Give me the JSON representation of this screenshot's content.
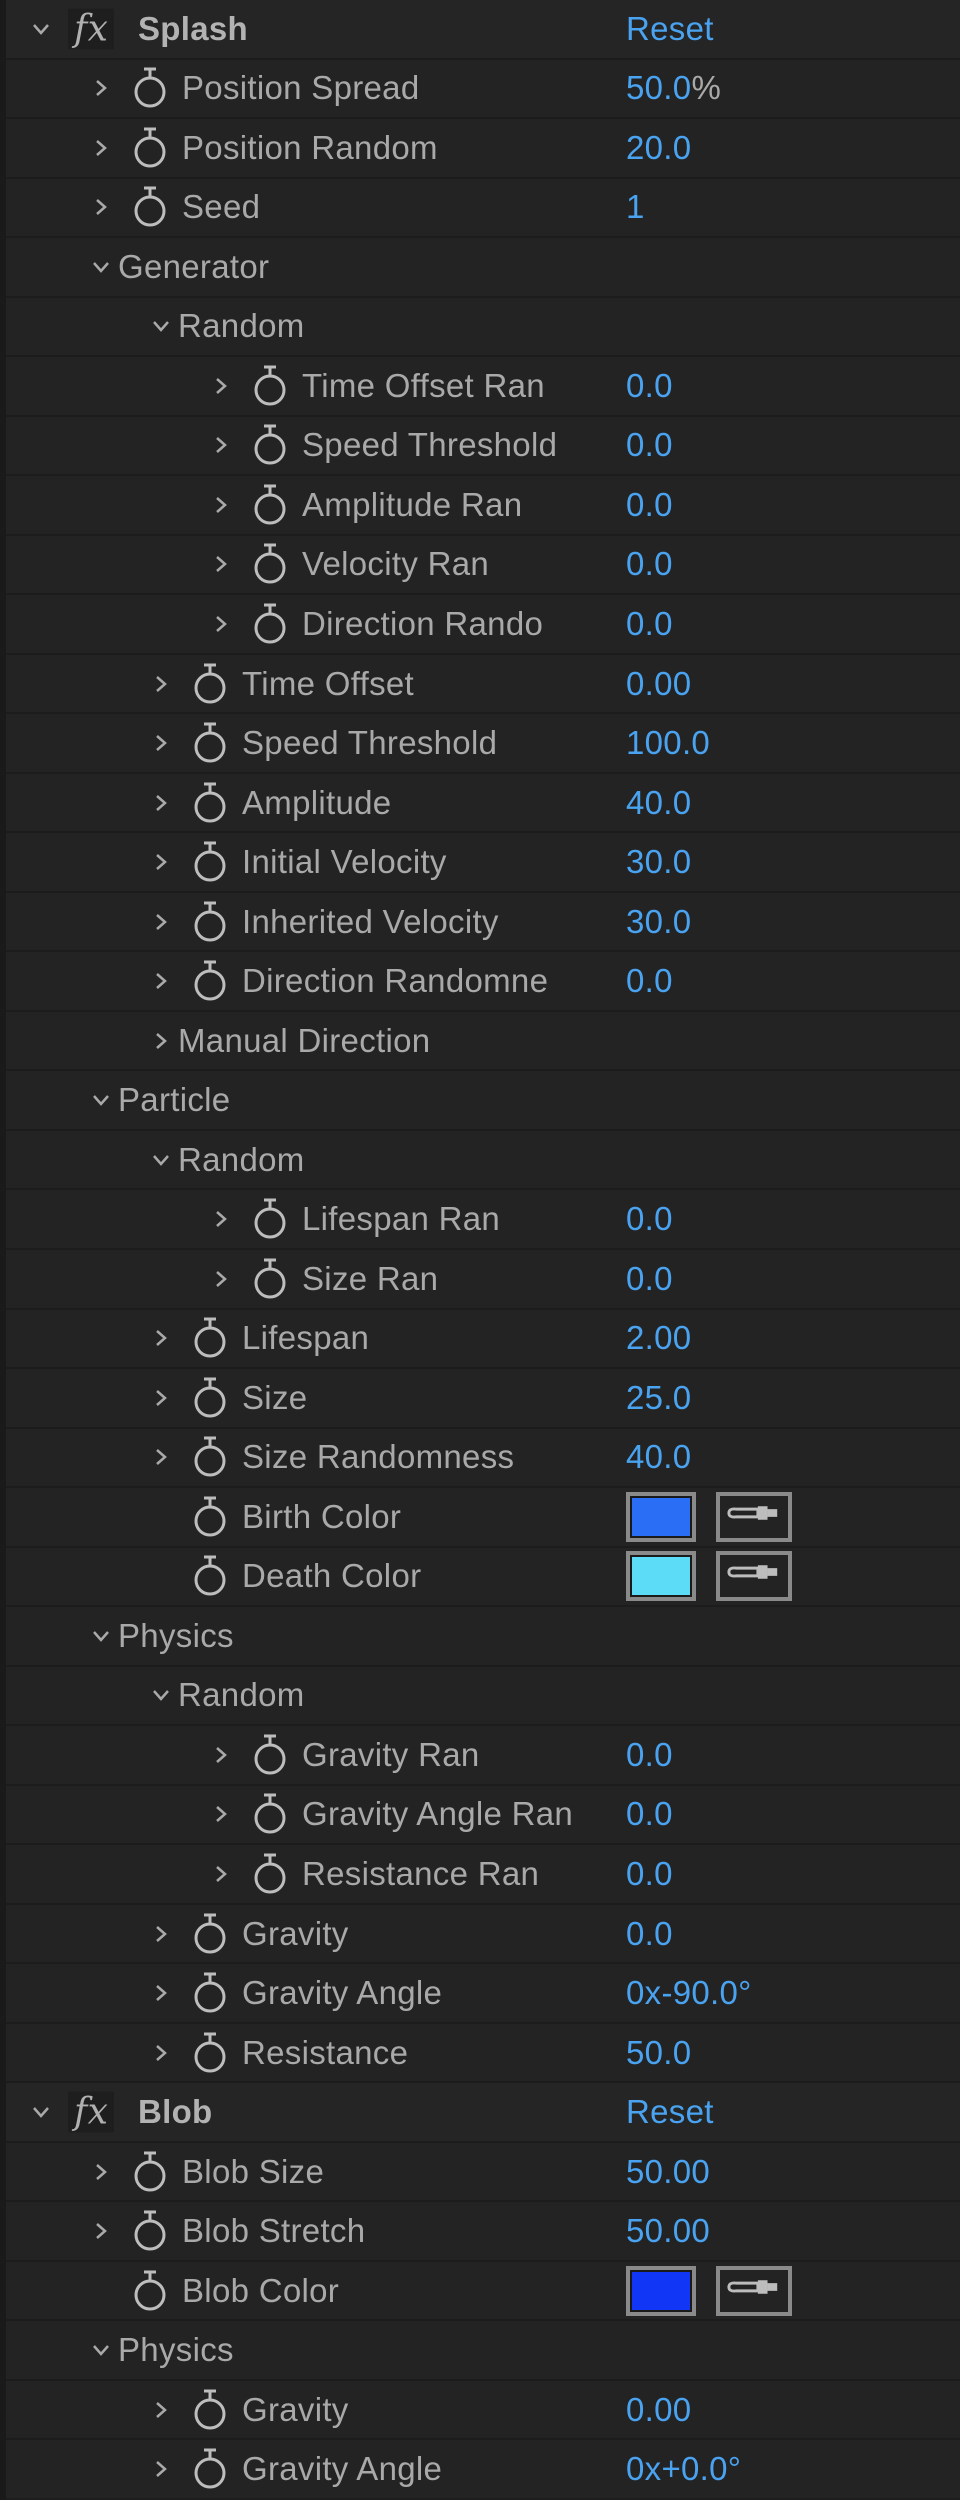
{
  "accent_color": "#4aa3f0",
  "rows": [
    {
      "level": 0,
      "kind": "effect",
      "chevron": "open",
      "label": "Splash",
      "reset": "Reset"
    },
    {
      "level": 1,
      "kind": "prop",
      "chevron": "closed",
      "label": "Position Spread",
      "value": "50.0",
      "unit": "%"
    },
    {
      "level": 1,
      "kind": "prop",
      "chevron": "closed",
      "label": "Position Random",
      "value": "20.0"
    },
    {
      "level": 1,
      "kind": "prop",
      "chevron": "closed",
      "label": "Seed",
      "value": "1"
    },
    {
      "level": 1,
      "kind": "group",
      "chevron": "open",
      "label": "Generator"
    },
    {
      "level": 2,
      "kind": "group",
      "chevron": "open",
      "label": "Random"
    },
    {
      "level": 3,
      "kind": "prop",
      "chevron": "closed",
      "label": "Time Offset Ran",
      "value": "0.0"
    },
    {
      "level": 3,
      "kind": "prop",
      "chevron": "closed",
      "label": "Speed Threshold",
      "value": "0.0"
    },
    {
      "level": 3,
      "kind": "prop",
      "chevron": "closed",
      "label": "Amplitude Ran",
      "value": "0.0"
    },
    {
      "level": 3,
      "kind": "prop",
      "chevron": "closed",
      "label": "Velocity Ran",
      "value": "0.0"
    },
    {
      "level": 3,
      "kind": "prop",
      "chevron": "closed",
      "label": "Direction Rando",
      "value": "0.0"
    },
    {
      "level": 2,
      "kind": "prop",
      "chevron": "closed",
      "label": "Time Offset",
      "value": "0.00"
    },
    {
      "level": 2,
      "kind": "prop",
      "chevron": "closed",
      "label": "Speed Threshold",
      "value": "100.0"
    },
    {
      "level": 2,
      "kind": "prop",
      "chevron": "closed",
      "label": "Amplitude",
      "value": "40.0"
    },
    {
      "level": 2,
      "kind": "prop",
      "chevron": "closed",
      "label": "Initial Velocity",
      "value": "30.0"
    },
    {
      "level": 2,
      "kind": "prop",
      "chevron": "closed",
      "label": "Inherited Velocity",
      "value": "30.0"
    },
    {
      "level": 2,
      "kind": "prop",
      "chevron": "closed",
      "label": "Direction Randomne",
      "value": "0.0"
    },
    {
      "level": 2,
      "kind": "group",
      "chevron": "closed",
      "label": "Manual Direction"
    },
    {
      "level": 1,
      "kind": "group",
      "chevron": "open",
      "label": "Particle"
    },
    {
      "level": 2,
      "kind": "group",
      "chevron": "open",
      "label": "Random"
    },
    {
      "level": 3,
      "kind": "prop",
      "chevron": "closed",
      "label": "Lifespan Ran",
      "value": "0.0"
    },
    {
      "level": 3,
      "kind": "prop",
      "chevron": "closed",
      "label": "Size Ran",
      "value": "0.0"
    },
    {
      "level": 2,
      "kind": "prop",
      "chevron": "closed",
      "label": "Lifespan",
      "value": "2.00"
    },
    {
      "level": 2,
      "kind": "prop",
      "chevron": "closed",
      "label": "Size",
      "value": "25.0"
    },
    {
      "level": 2,
      "kind": "prop",
      "chevron": "closed",
      "label": "Size Randomness",
      "value": "40.0"
    },
    {
      "level": 2,
      "kind": "color",
      "chevron": "none",
      "label": "Birth Color",
      "color": "#2a6ef5"
    },
    {
      "level": 2,
      "kind": "color",
      "chevron": "none",
      "label": "Death Color",
      "color": "#5ddcf8"
    },
    {
      "level": 1,
      "kind": "group",
      "chevron": "open",
      "label": "Physics"
    },
    {
      "level": 2,
      "kind": "group",
      "chevron": "open",
      "label": "Random"
    },
    {
      "level": 3,
      "kind": "prop",
      "chevron": "closed",
      "label": "Gravity Ran",
      "value": "0.0"
    },
    {
      "level": 3,
      "kind": "prop",
      "chevron": "closed",
      "label": "Gravity Angle Ran",
      "value": "0.0"
    },
    {
      "level": 3,
      "kind": "prop",
      "chevron": "closed",
      "label": "Resistance Ran",
      "value": "0.0"
    },
    {
      "level": 2,
      "kind": "prop",
      "chevron": "closed",
      "label": "Gravity",
      "value": "0.0"
    },
    {
      "level": 2,
      "kind": "prop",
      "chevron": "closed",
      "label": "Gravity Angle",
      "value": "0x-90.0°"
    },
    {
      "level": 2,
      "kind": "prop",
      "chevron": "closed",
      "label": "Resistance",
      "value": "50.0"
    },
    {
      "level": 0,
      "kind": "effect",
      "chevron": "open",
      "label": "Blob",
      "reset": "Reset"
    },
    {
      "level": 1,
      "kind": "prop",
      "chevron": "closed",
      "label": "Blob Size",
      "value": "50.00"
    },
    {
      "level": 1,
      "kind": "prop",
      "chevron": "closed",
      "label": "Blob Stretch",
      "value": "50.00"
    },
    {
      "level": 1,
      "kind": "color",
      "chevron": "none",
      "label": "Blob Color",
      "color": "#1236f5"
    },
    {
      "level": 1,
      "kind": "group",
      "chevron": "open",
      "label": "Physics"
    },
    {
      "level": 2,
      "kind": "prop",
      "chevron": "closed",
      "label": "Gravity",
      "value": "0.00"
    },
    {
      "level": 2,
      "kind": "prop",
      "chevron": "closed",
      "label": "Gravity Angle",
      "value": "0x+0.0°"
    }
  ],
  "icons": {
    "fx": "fx",
    "stopwatch": "stopwatch-icon",
    "eyedropper": "eyedropper-icon",
    "chevron_open": "chevron-down-icon",
    "chevron_closed": "chevron-right-icon"
  }
}
